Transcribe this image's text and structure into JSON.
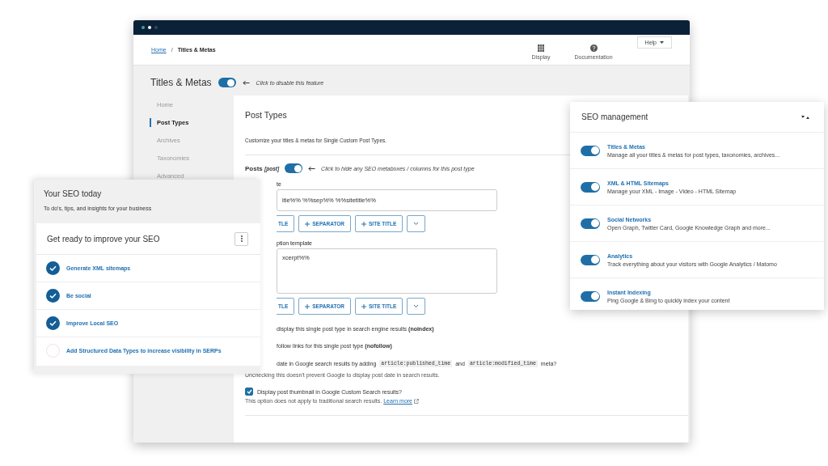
{
  "window": {
    "breadcrumb": [
      {
        "label": "Home",
        "link": true
      },
      {
        "label": "Titles & Metas",
        "link": false
      }
    ],
    "header_actions": [
      {
        "kind": "display",
        "label": "Display"
      },
      {
        "kind": "docs",
        "label": "Documentation"
      }
    ],
    "breadcrumb_separator": "/",
    "help_button": "Help"
  },
  "page": {
    "title": "Titles & Metas",
    "enabled": true,
    "hint": "Click to disable this feature"
  },
  "sidebar": {
    "items": [
      {
        "label": "Home",
        "selected": false
      },
      {
        "label": "Post Types",
        "selected": true
      },
      {
        "label": "Archives",
        "selected": false
      },
      {
        "label": "Taxonomies",
        "selected": false
      },
      {
        "label": "Advanced",
        "selected": false
      }
    ]
  },
  "card": {
    "title": "Post Types",
    "description": "Customize your titles & metas for Single Custom Post Types.",
    "section": {
      "name": "Posts",
      "slug": "[post]",
      "enabled": true,
      "hint": "Click to hide any SEO metaboxes / columns for this post type"
    },
    "title_field": {
      "label": "te",
      "value": "itle%% %%sep%% %%sitetitle%%"
    },
    "title_buttons": [
      {
        "kind": "partial",
        "label": "TLE"
      },
      {
        "kind": "add",
        "label": "SEPARATOR"
      },
      {
        "kind": "add",
        "label": "SITE TITLE"
      },
      {
        "kind": "more"
      }
    ],
    "description_field": {
      "label": "ption template",
      "value": "xcerpt%%"
    },
    "description_buttons": [
      {
        "kind": "partial",
        "label": "TLE"
      },
      {
        "kind": "add",
        "label": "SEPARATOR"
      },
      {
        "kind": "add",
        "label": "SITE TITLE"
      },
      {
        "kind": "more"
      }
    ],
    "options": [
      {
        "kind": "line",
        "text": "display this single post type in search engine results **(noindex)**"
      },
      {
        "kind": "line",
        "text": "follow links for this single post type **(nofollow)**"
      },
      {
        "kind": "parts",
        "parts": [
          {
            "text": "date in Google search results by adding",
            "code": false
          },
          {
            "text": "article:published_time",
            "code": true
          },
          {
            "text": "and",
            "code": false
          },
          {
            "text": "article:modified_time",
            "code": true
          },
          {
            "text": "meta?",
            "code": false
          }
        ],
        "note": "Unchecking this doesn't prevent Google to display post date in search results."
      },
      {
        "kind": "checkbox",
        "label": "Display post thumbnail in Google Custom Search results?",
        "checked": true,
        "note": "This option does not apply to traditional search results.",
        "link": "Learn more"
      }
    ]
  },
  "seo_today": {
    "title": "Your SEO today",
    "subtitle": "To do's, tips, and insights for your business",
    "card": {
      "title": "Get ready to improve your SEO",
      "tasks": [
        {
          "label": "Generate XML sitemaps",
          "done": true
        },
        {
          "label": "Be social",
          "done": true
        },
        {
          "label": "Improve Local SEO",
          "done": true
        },
        {
          "label": "Add Structured Data Types to increase visibility in SERPs",
          "done": false
        }
      ]
    }
  },
  "seo_management": {
    "title": "SEO management",
    "modules": [
      {
        "name": "Titles & Metas",
        "description": "Manage all your titles & metas for post types, taxonomies, archives...",
        "enabled": true
      },
      {
        "name": "XML & HTML Sitemaps",
        "description": "Manage your XML - Image - Video - HTML Sitemap",
        "enabled": true
      },
      {
        "name": "Social Networks",
        "description": "Open Graph, Twitter Card, Google Knowledge Graph and more...",
        "enabled": true
      },
      {
        "name": "Analytics",
        "description": "Track everything about your visitors with Google Analytics / Matomo",
        "enabled": true
      },
      {
        "name": "Instant Indexing",
        "description": "Ping Google & Bing to quickly index your content",
        "enabled": true
      }
    ]
  }
}
